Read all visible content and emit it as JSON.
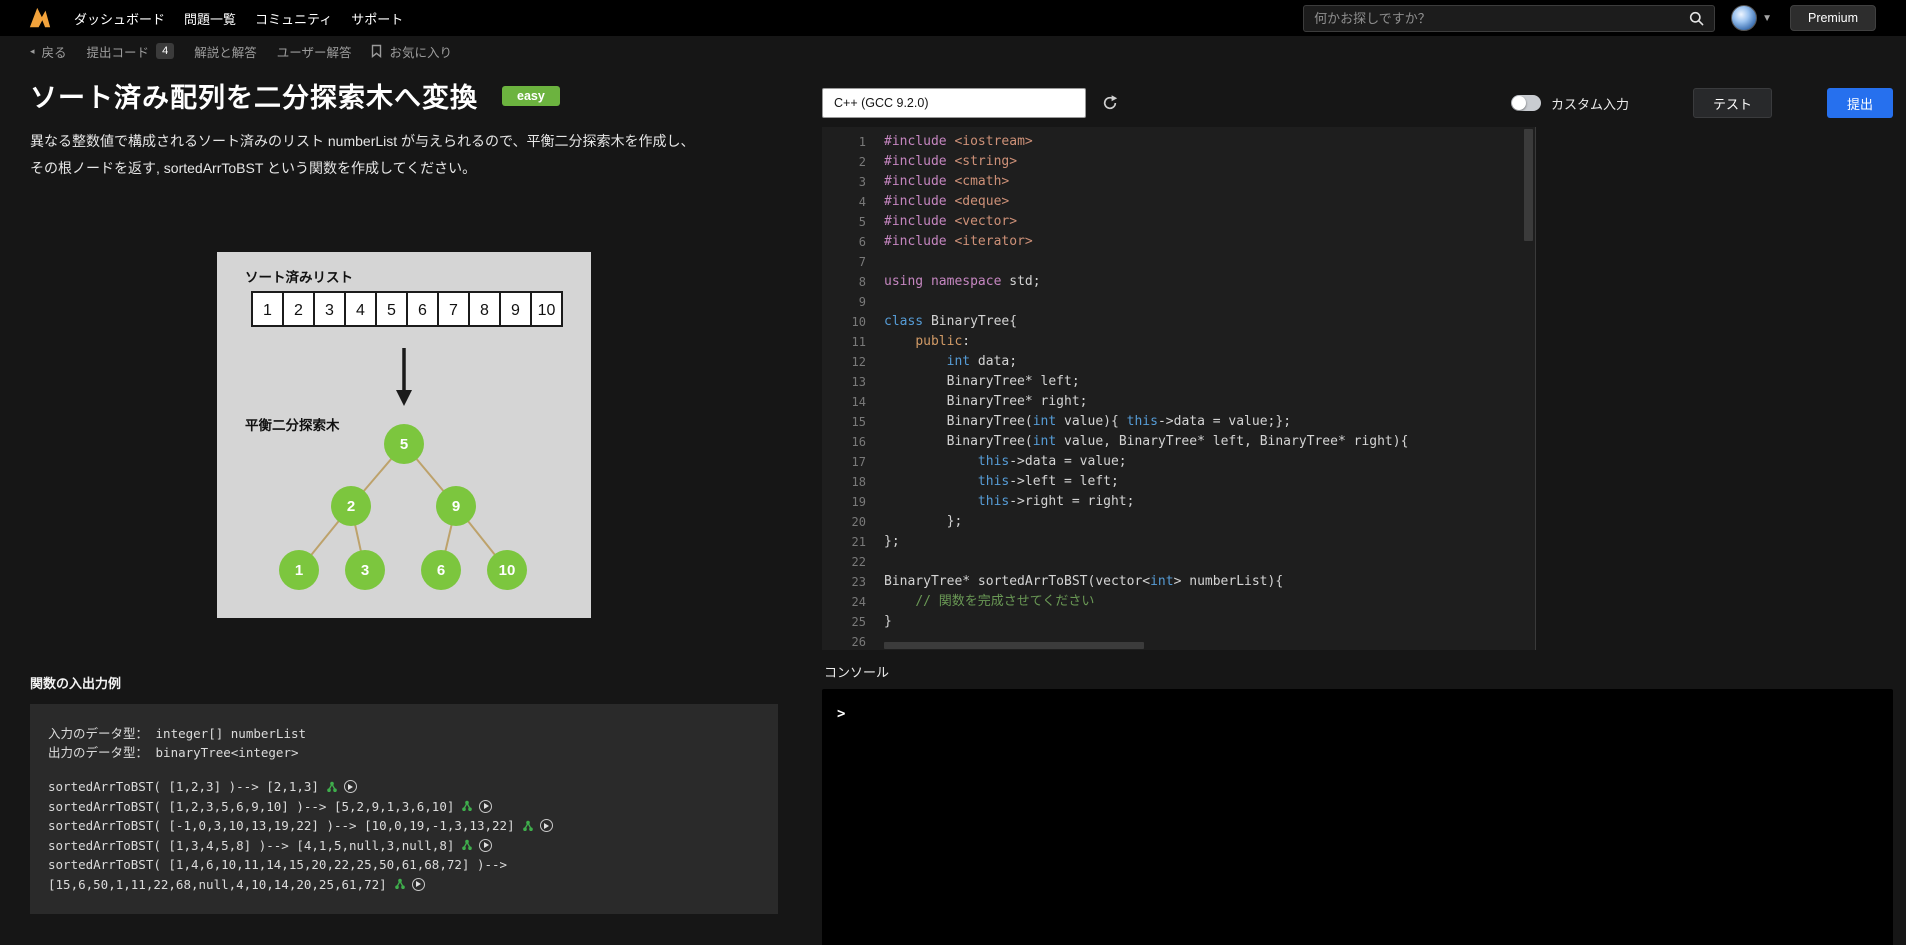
{
  "colors": {
    "accent_blue": "#2670EE",
    "difficulty_green": "#6CB33F",
    "logo_orange": "#F2A33C",
    "tree_node_green": "#7CC63E"
  },
  "navbar": {
    "items": [
      {
        "label": "ダッシュボード"
      },
      {
        "label": "問題一覧"
      },
      {
        "label": "コミュニティ"
      },
      {
        "label": "サポート"
      }
    ],
    "search_placeholder": "何かお探しですか？",
    "premium_label": "Premium"
  },
  "subnav": {
    "back_label": "戻る",
    "items": [
      {
        "label": "提出コード",
        "badge": "4"
      },
      {
        "label": "解説と解答"
      },
      {
        "label": "ユーザー解答"
      },
      {
        "label": "お気に入り"
      }
    ]
  },
  "problem": {
    "title": "ソート済み配列を二分探索木へ変換",
    "difficulty": "easy",
    "description": [
      "異なる整数値で構成されるソート済みのリスト numberList が与えられるので、平衡二分探索木を作成し、",
      "その根ノードを返す, sortedArrToBST という関数を作成してください。"
    ],
    "diagram": {
      "list_label": "ソート済みリスト",
      "list_values": [
        "1",
        "2",
        "3",
        "4",
        "5",
        "6",
        "7",
        "8",
        "9",
        "10"
      ],
      "tree_label": "平衡二分探索木",
      "tree_nodes": [
        "5",
        "2",
        "9",
        "1",
        "3",
        "6",
        "10"
      ]
    },
    "io": {
      "title": "関数の入出力例",
      "input_type": "入力のデータ型： integer[] numberList",
      "output_type": "出力のデータ型： binaryTree<integer>",
      "examples": [
        {
          "line": "sortedArrToBST( [1,2,3] )--> [2,1,3]",
          "wrap": ""
        },
        {
          "line": "sortedArrToBST( [1,2,3,5,6,9,10] )--> [5,2,9,1,3,6,10]",
          "wrap": ""
        },
        {
          "line": "sortedArrToBST( [-1,0,3,10,13,19,22] )--> [10,0,19,-1,3,13,22]",
          "wrap": ""
        },
        {
          "line": "sortedArrToBST( [1,3,4,5,8] )--> [4,1,5,null,3,null,8]",
          "wrap": ""
        },
        {
          "line": "sortedArrToBST( [1,4,6,10,11,14,15,20,22,25,50,61,68,72] )-->",
          "wrap": "[15,6,50,1,11,22,68,null,4,10,14,20,25,61,72]"
        }
      ]
    }
  },
  "editor": {
    "language": "C++ (GCC 9.2.0)",
    "custom_input_label": "カスタム入力",
    "test_label": "テスト",
    "submit_label": "提出",
    "code_lines": [
      [
        [
          "pp",
          "#include"
        ],
        [
          "d",
          " "
        ],
        [
          "s",
          "<iostream>"
        ]
      ],
      [
        [
          "pp",
          "#include"
        ],
        [
          "d",
          " "
        ],
        [
          "s",
          "<string>"
        ]
      ],
      [
        [
          "pp",
          "#include"
        ],
        [
          "d",
          " "
        ],
        [
          "s",
          "<cmath>"
        ]
      ],
      [
        [
          "pp",
          "#include"
        ],
        [
          "d",
          " "
        ],
        [
          "s",
          "<deque>"
        ]
      ],
      [
        [
          "pp",
          "#include"
        ],
        [
          "d",
          " "
        ],
        [
          "s",
          "<vector>"
        ]
      ],
      [
        [
          "pp",
          "#include"
        ],
        [
          "d",
          " "
        ],
        [
          "s",
          "<iterator>"
        ]
      ],
      [],
      [
        [
          "pp",
          "using"
        ],
        [
          "d",
          " "
        ],
        [
          "pp",
          "namespace"
        ],
        [
          "d",
          " std;"
        ]
      ],
      [],
      [
        [
          "kw",
          "class"
        ],
        [
          "d",
          " BinaryTree{"
        ]
      ],
      [
        [
          "d",
          "    "
        ],
        [
          "pub",
          "public"
        ],
        [
          "d",
          ":"
        ]
      ],
      [
        [
          "d",
          "        "
        ],
        [
          "kw",
          "int"
        ],
        [
          "d",
          " data;"
        ]
      ],
      [
        [
          "d",
          "        BinaryTree* left;"
        ]
      ],
      [
        [
          "d",
          "        BinaryTree* right;"
        ]
      ],
      [
        [
          "d",
          "        BinaryTree("
        ],
        [
          "kw",
          "int"
        ],
        [
          "d",
          " value){ "
        ],
        [
          "kw",
          "this"
        ],
        [
          "d",
          "->data = value;};"
        ]
      ],
      [
        [
          "d",
          "        BinaryTree("
        ],
        [
          "kw",
          "int"
        ],
        [
          "d",
          " value, BinaryTree* left, BinaryTree* right){"
        ]
      ],
      [
        [
          "d",
          "            "
        ],
        [
          "kw",
          "this"
        ],
        [
          "d",
          "->data = value;"
        ]
      ],
      [
        [
          "d",
          "            "
        ],
        [
          "kw",
          "this"
        ],
        [
          "d",
          "->left = left;"
        ]
      ],
      [
        [
          "d",
          "            "
        ],
        [
          "kw",
          "this"
        ],
        [
          "d",
          "->right = right;"
        ]
      ],
      [
        [
          "d",
          "        };"
        ]
      ],
      [
        [
          "d",
          "};"
        ]
      ],
      [],
      [
        [
          "d",
          "BinaryTree* sortedArrToBST(vector<"
        ],
        [
          "kw",
          "int"
        ],
        [
          "d",
          "> numberList){"
        ]
      ],
      [
        [
          "d",
          "    "
        ],
        [
          "c",
          "// 関数を完成させてください"
        ]
      ],
      [
        [
          "d",
          "}"
        ]
      ],
      [],
      []
    ]
  },
  "console": {
    "title": "コンソール",
    "prompt": ">"
  }
}
